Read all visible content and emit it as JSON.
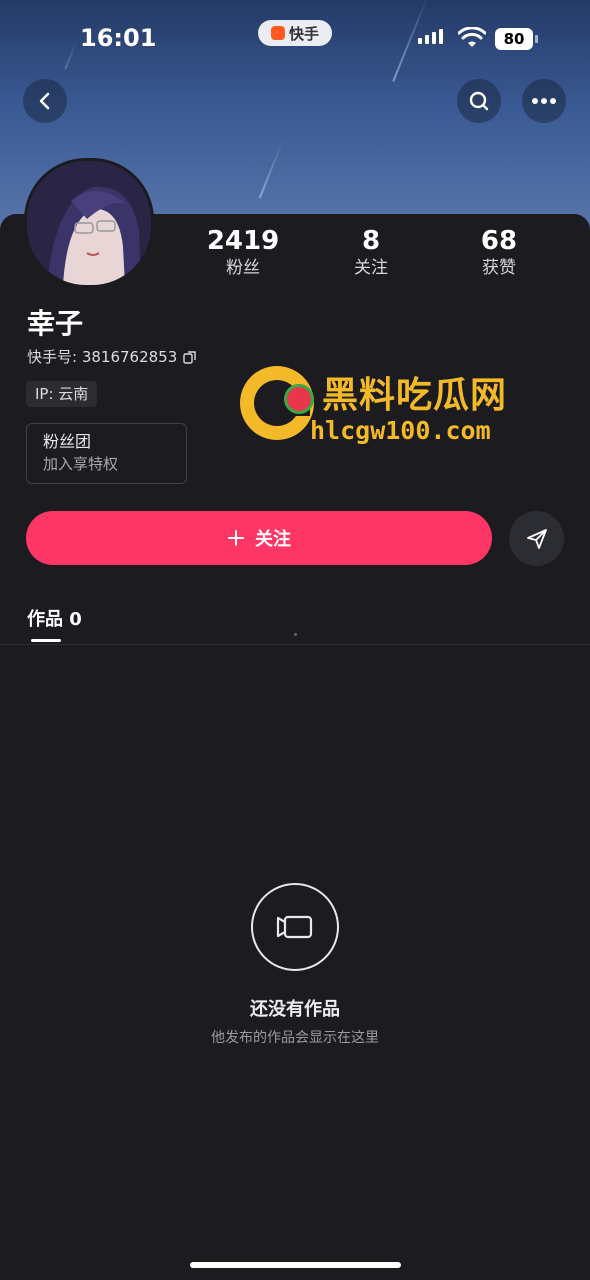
{
  "status_bar": {
    "time": "16:01",
    "app_name": "快手",
    "battery": "80"
  },
  "profile": {
    "name": "幸子",
    "kuaishou_id": "快手号: 3816762853",
    "ip_location": "IP: 云南",
    "stats": [
      {
        "value": "2419",
        "label": "粉丝"
      },
      {
        "value": "8",
        "label": "关注"
      },
      {
        "value": "68",
        "label": "获赞"
      }
    ],
    "fan_club": {
      "title": "粉丝团",
      "subtitle": "加入享特权"
    }
  },
  "actions": {
    "follow_label": "关注"
  },
  "tabs": [
    {
      "label": "作品 0",
      "active": true
    }
  ],
  "empty_state": {
    "title": "还没有作品",
    "subtitle": "他发布的作品会显示在这里"
  },
  "watermark": {
    "text_cn": "黑料吃瓜网",
    "url": "hlcgw100.com"
  },
  "colors": {
    "accent": "#fe3666",
    "background": "#1b1b20",
    "watermark": "#f3b928"
  },
  "icons": [
    "back-icon",
    "search-icon",
    "more-icon",
    "copy-icon",
    "plus-icon",
    "share-send-icon",
    "video-camera-icon"
  ]
}
